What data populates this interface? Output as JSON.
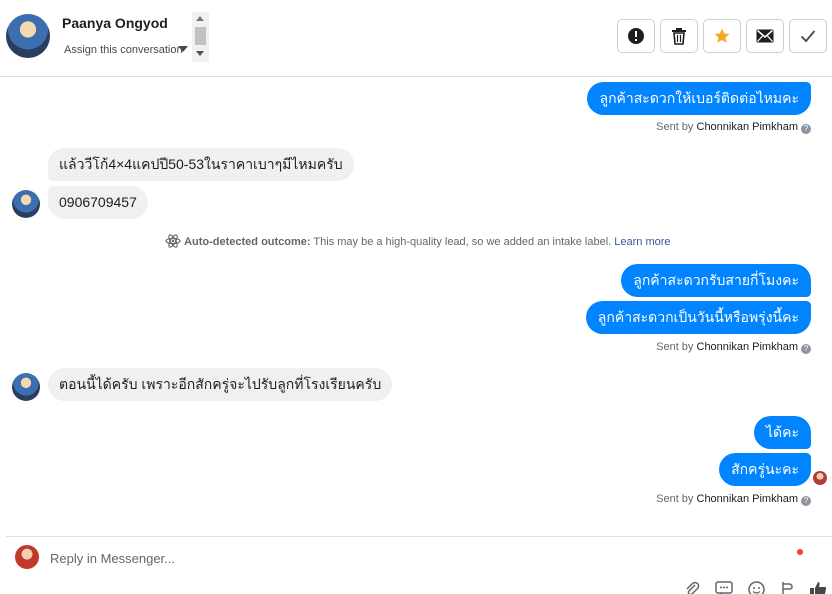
{
  "header": {
    "contact_name": "Paanya Ongyod",
    "assign_label": "Assign this conversation",
    "actions": [
      {
        "name": "spam",
        "icon": "exclamation-icon"
      },
      {
        "name": "delete",
        "icon": "trash-icon"
      },
      {
        "name": "star",
        "icon": "star-icon",
        "color": "#f5a623"
      },
      {
        "name": "mark-unread",
        "icon": "envelope-icon"
      },
      {
        "name": "done",
        "icon": "checkmark-icon"
      }
    ]
  },
  "messages": {
    "m1": "ลูกค้าสะดวกให้เบอร์ติดต่อไหมคะ",
    "sent1_prefix": "Sent by",
    "sent1_name": "Chonnikan Pimkham",
    "m2": "แล้ววีโก้4×4แคปปี50-53ในราคาเบาๆมีไหมครับ",
    "m3": "0906709457",
    "auto_label": "Auto-detected outcome:",
    "auto_text": "This may be a high-quality lead, so we added an intake label.",
    "auto_link": "Learn more",
    "m4": "ลูกค้าสะดวกรับสายกี่โมงคะ",
    "m5": "ลูกค้าสะดวกเป็นวันนี้หรือพรุ่งนี้คะ",
    "sent2_prefix": "Sent by",
    "sent2_name": "Chonnikan Pimkham",
    "m6": "ตอนนี้ได้ครับ เพราะอีกสักครู่จะไปรับลูกที่โรงเรียนครับ",
    "m7": "ได้คะ",
    "m8": "สักครู่นะคะ",
    "sent3_prefix": "Sent by",
    "sent3_name": "Chonnikan Pimkham"
  },
  "composer": {
    "placeholder": "Reply in Messenger...",
    "tools": [
      "paperclip-icon",
      "saved-reply-icon",
      "emoji-icon",
      "appointment-icon",
      "like-icon"
    ]
  },
  "colors": {
    "outgoing_bubble": "#0084ff",
    "incoming_bubble": "#f0f0f0",
    "star": "#f5a623"
  }
}
